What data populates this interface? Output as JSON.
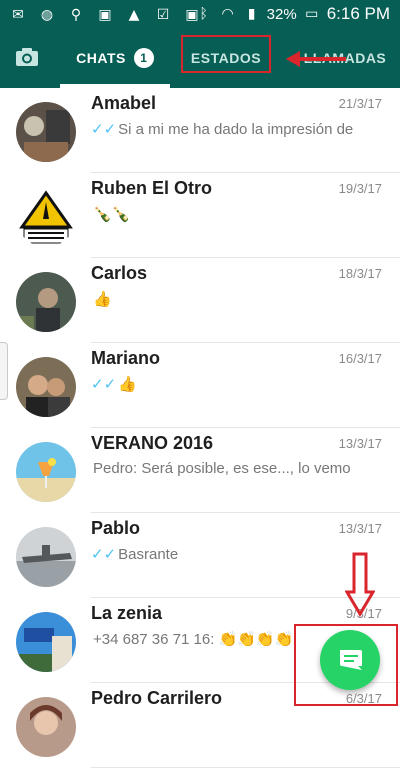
{
  "status_bar": {
    "battery": "32%",
    "time": "6:16 PM"
  },
  "tabs": {
    "chats_label": "CHATS",
    "chats_badge": "1",
    "estados_label": "ESTADOS",
    "llamadas_label": "LLAMADAS"
  },
  "chats": [
    {
      "name": "Amabel",
      "date": "21/3/17",
      "preview": "Si a mi me ha dado la impresión de",
      "ticks": "✓✓"
    },
    {
      "name": "Ruben El Otro",
      "date": "19/3/17",
      "preview": "🍾🍾",
      "ticks": ""
    },
    {
      "name": "Carlos",
      "date": "18/3/17",
      "preview": "👍",
      "ticks": ""
    },
    {
      "name": "Mariano",
      "date": "16/3/17",
      "preview": "👍",
      "ticks": "✓✓"
    },
    {
      "name": "VERANO 2016",
      "date": "13/3/17",
      "preview": "Pedro: Será posible, es ese..., lo vemo",
      "ticks": ""
    },
    {
      "name": "Pablo",
      "date": "13/3/17",
      "preview": "Basrante",
      "ticks": "✓✓"
    },
    {
      "name": "La zenia",
      "date": "9/3/17",
      "preview": "+34 687 36 71 16: 👏👏👏👏",
      "ticks": ""
    },
    {
      "name": "Pedro Carrilero",
      "date": "6/3/17",
      "preview": "",
      "ticks": ""
    }
  ],
  "colors": {
    "header": "#075e54",
    "fab": "#25d366",
    "ticks": "#4fc3f7",
    "annotation": "#d8262c"
  },
  "icons": [
    "camera-icon",
    "new-chat-icon",
    "read-receipt-icon"
  ]
}
